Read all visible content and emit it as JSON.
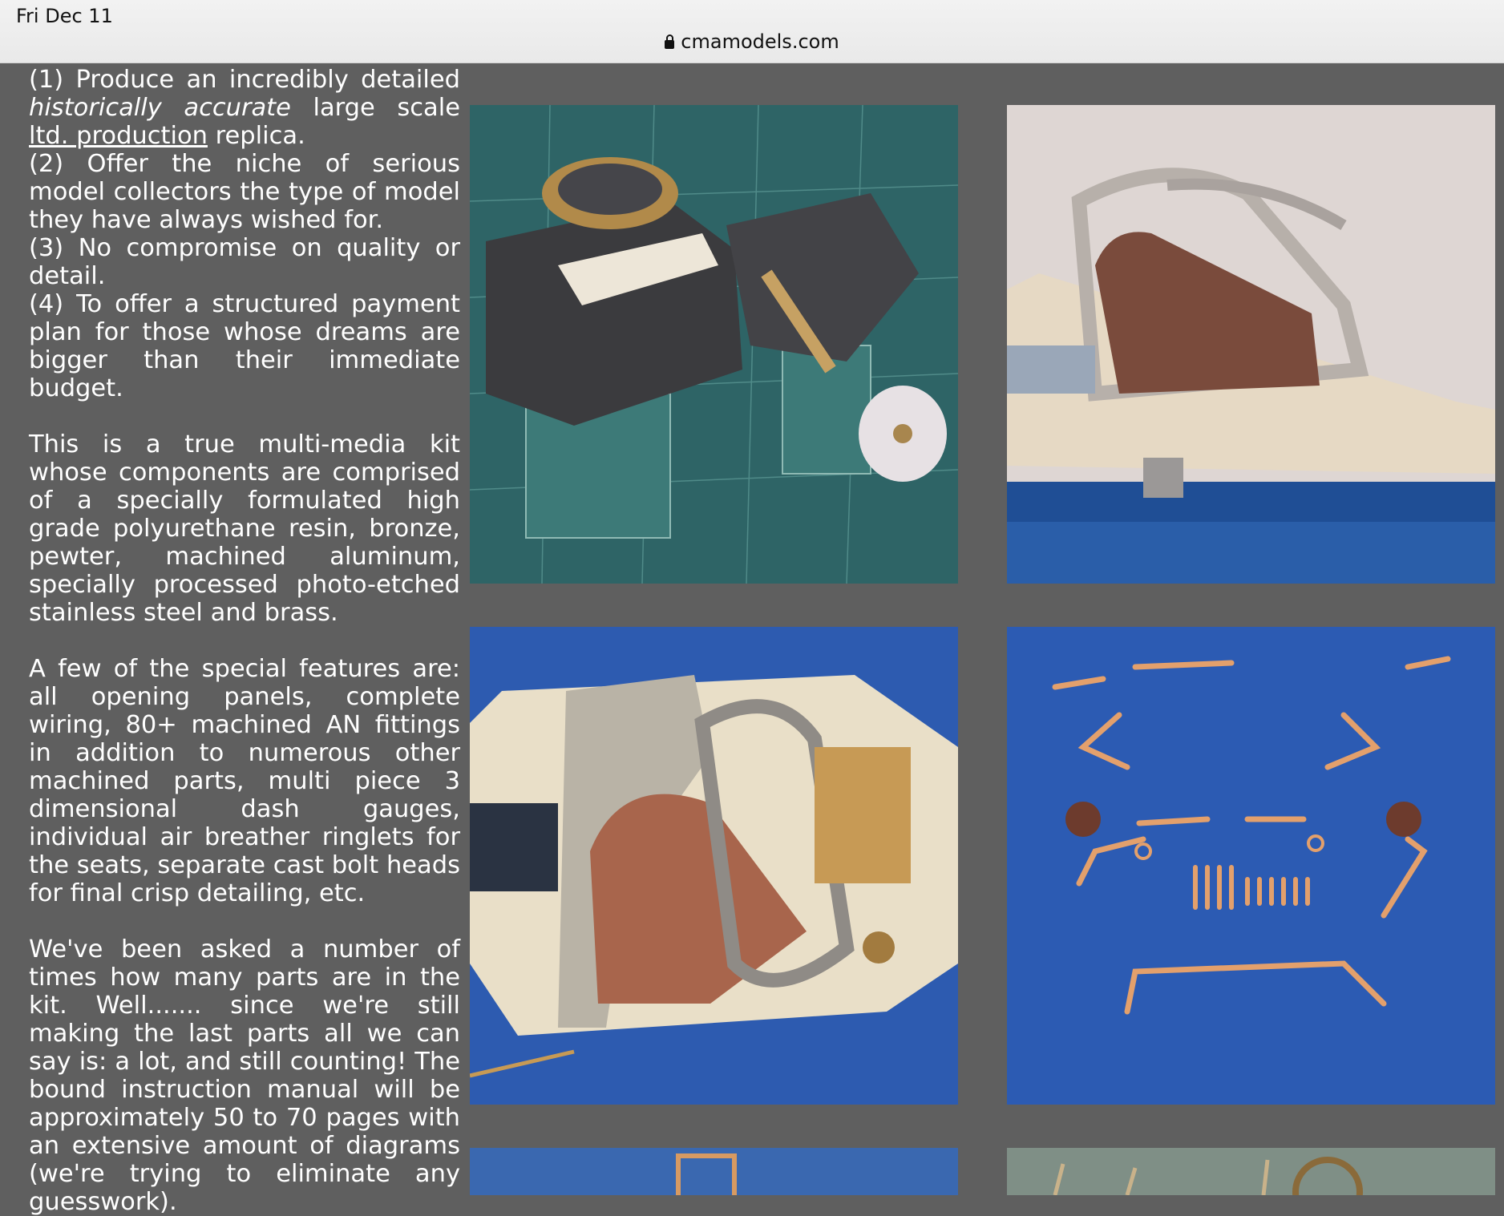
{
  "status_bar": {
    "date": "Fri Dec 11",
    "url": "cmamodels.com"
  },
  "article": {
    "p1_a": "(1) Produce an incredibly detailed ",
    "p1_italic": "historically accurate",
    "p1_b": " large scale ",
    "p1_underline": "ltd. production",
    "p1_c": " replica.",
    "p2": "(2) Offer the niche of serious model collectors the type of model they have always wished for.",
    "p3": "(3) No compromise on quality or detail.",
    "p4": "(4) To offer a structured payment plan for those whose dreams are bigger than their immediate budget.",
    "p5": "This is a true multi-media kit whose components are comprised of a specially formulated high grade polyurethane resin, bronze, pewter, machined aluminum, specially processed photo-etched stainless steel and brass.",
    "p6": "A few of the special features are: all opening panels, complete wiring, 80+ machined AN fittings in addition to numerous other machined parts, multi piece 3 dimensional dash gauges, individual air breather ringlets for the seats, separate cast bolt heads for final crisp detailing, etc.",
    "p7": "We've been asked a number of times how many parts are in the kit. Well....... since we're still making the last parts all we can say is: a lot, and still counting! The bound instruction manual will be approximately 50 to 70 pages with an extensive amount of diagrams (we're trying to eliminate any guesswork)."
  },
  "photos": {
    "engine_bg": "#2e6466",
    "chassis_bg": "#ded6d3",
    "cockpit_bg": "#2d5bb0",
    "parts_bg": "#2c5bb3",
    "partial_left_bg": "#3a68b0",
    "partial_right_bg": "#7f8f86"
  },
  "icons": {
    "lock": "lock-icon"
  }
}
